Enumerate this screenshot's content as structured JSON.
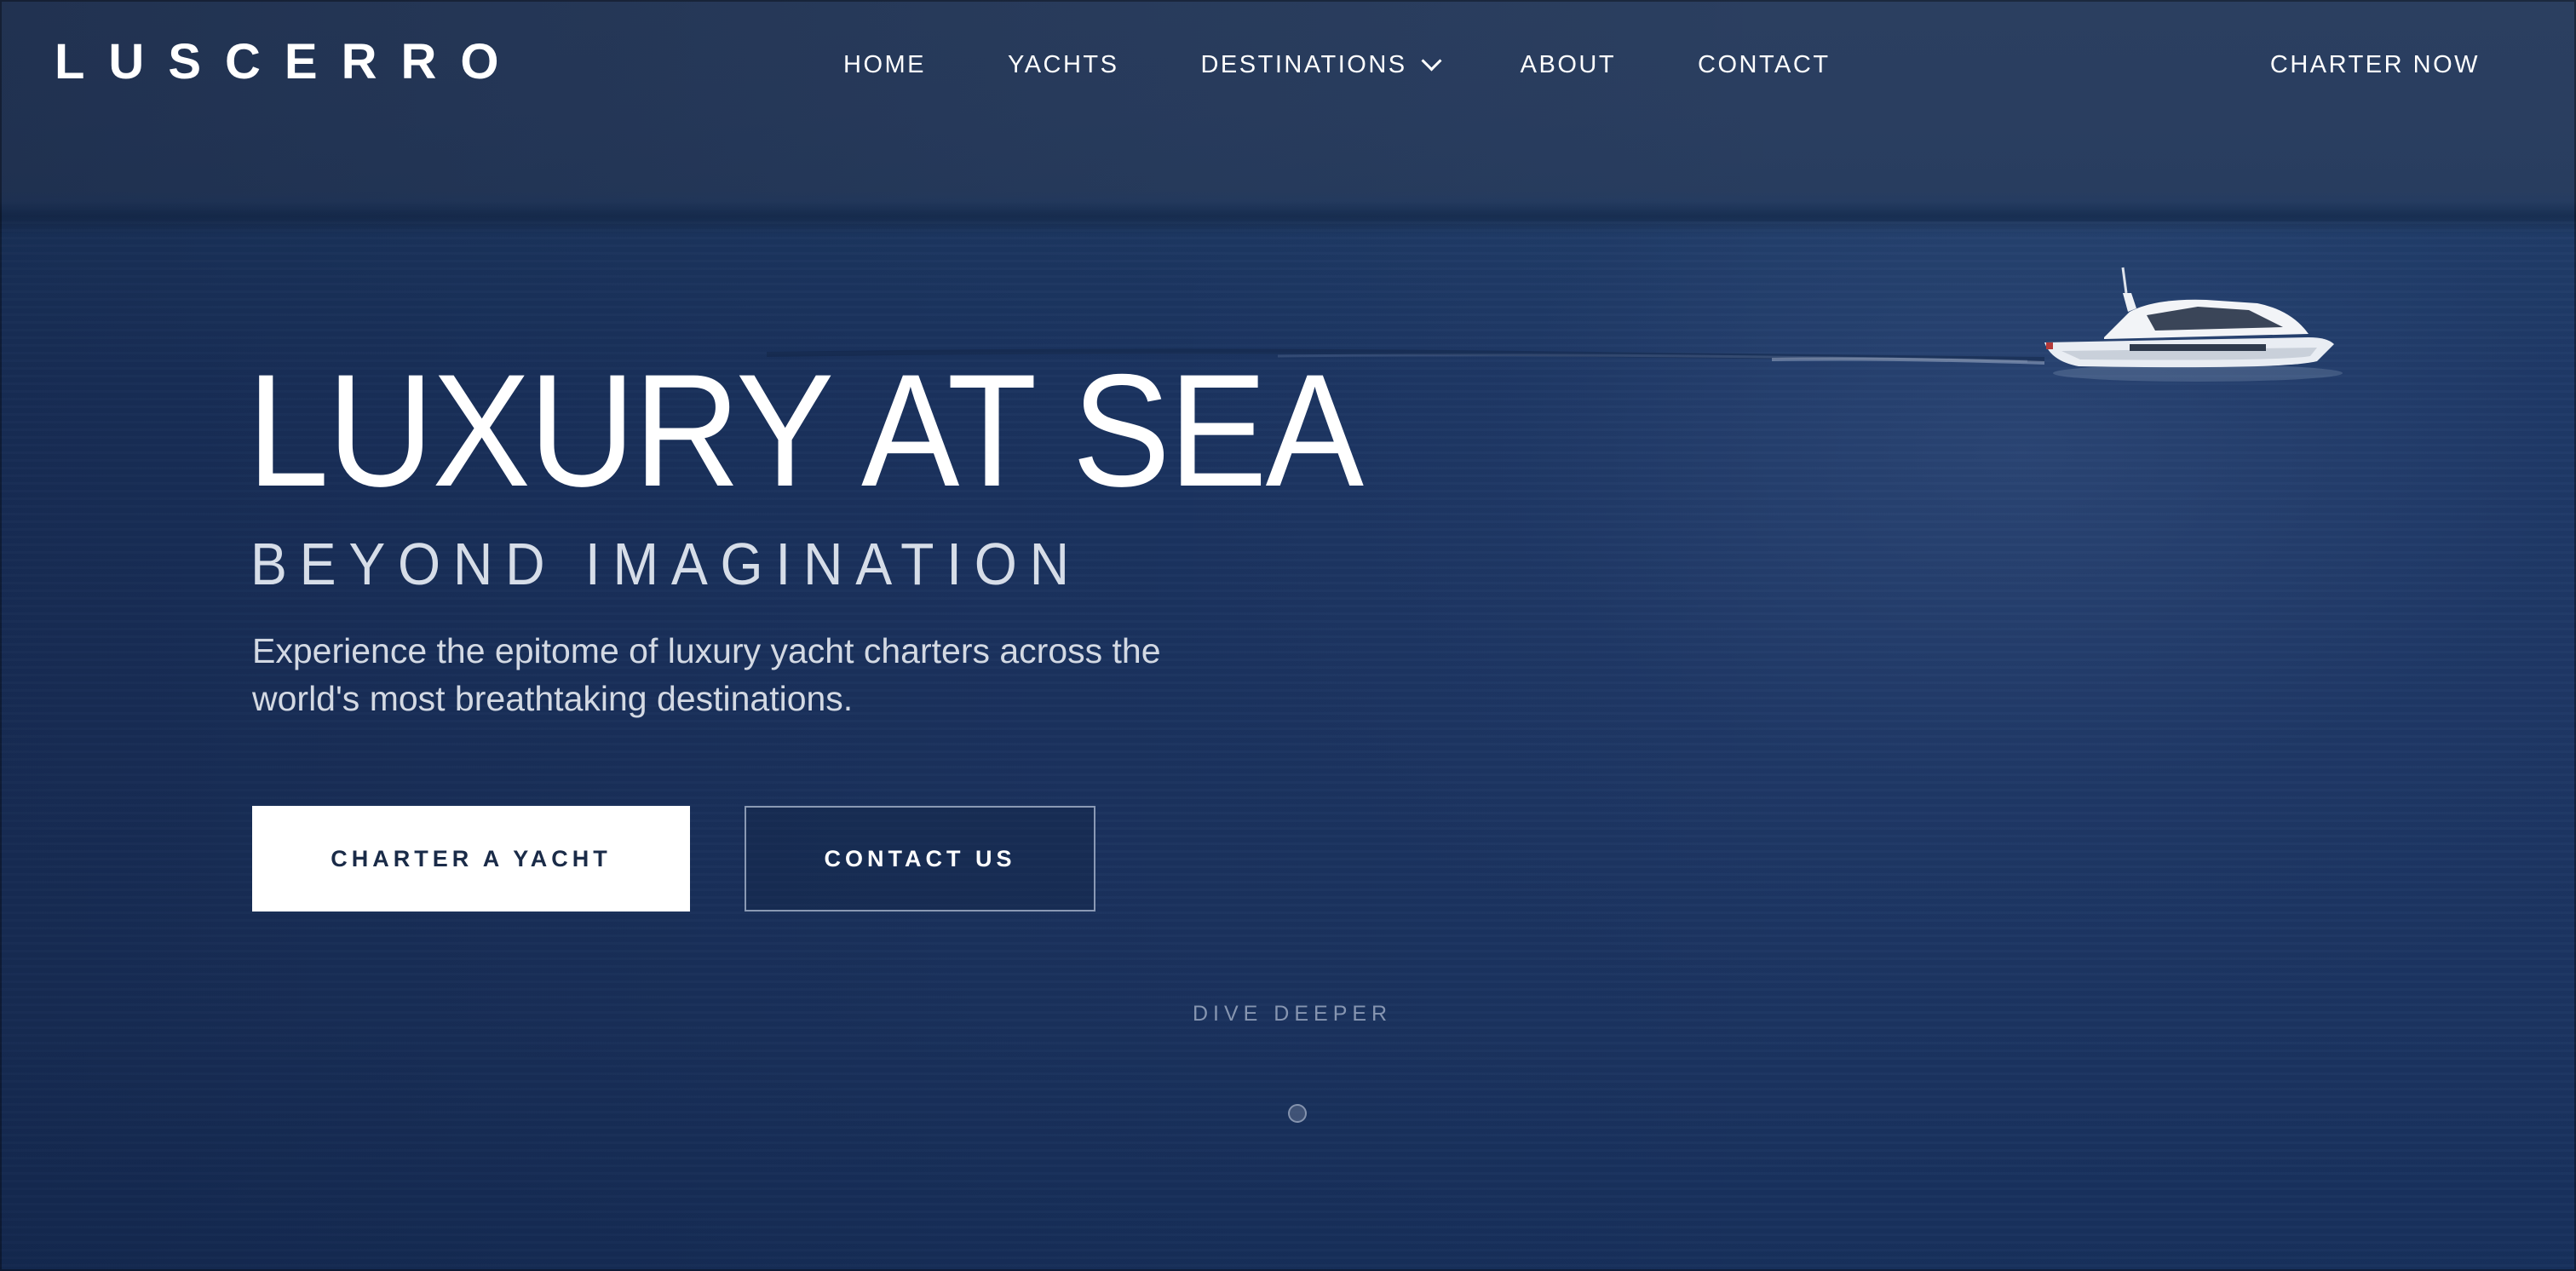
{
  "brand": {
    "logo_text": "LUSCERRO"
  },
  "nav": {
    "items": [
      {
        "label": "HOME"
      },
      {
        "label": "YACHTS"
      },
      {
        "label": "DESTINATIONS",
        "has_dropdown": true
      },
      {
        "label": "ABOUT"
      },
      {
        "label": "CONTACT"
      }
    ],
    "cta_label": "CHARTER NOW",
    "dropdown_icon": "chevron-down-icon"
  },
  "hero": {
    "headline": "LUXURY AT SEA",
    "subheadline": "BEYOND IMAGINATION",
    "description": "Experience the epitome of luxury yacht charters across the world's most breathtaking destinations.",
    "primary_button": "CHARTER A YACHT",
    "secondary_button": "CONTACT US",
    "scroll_hint": "DIVE DEEPER",
    "scroll_indicator_icon": "scroll-dot-icon",
    "background_image": "yacht-on-sea-photo"
  },
  "colors": {
    "overlay": "#1c3563",
    "button_primary_bg": "#ffffff",
    "button_primary_text": "#1a2b48",
    "text": "#ffffff",
    "muted_text": "#d3d9e3"
  }
}
